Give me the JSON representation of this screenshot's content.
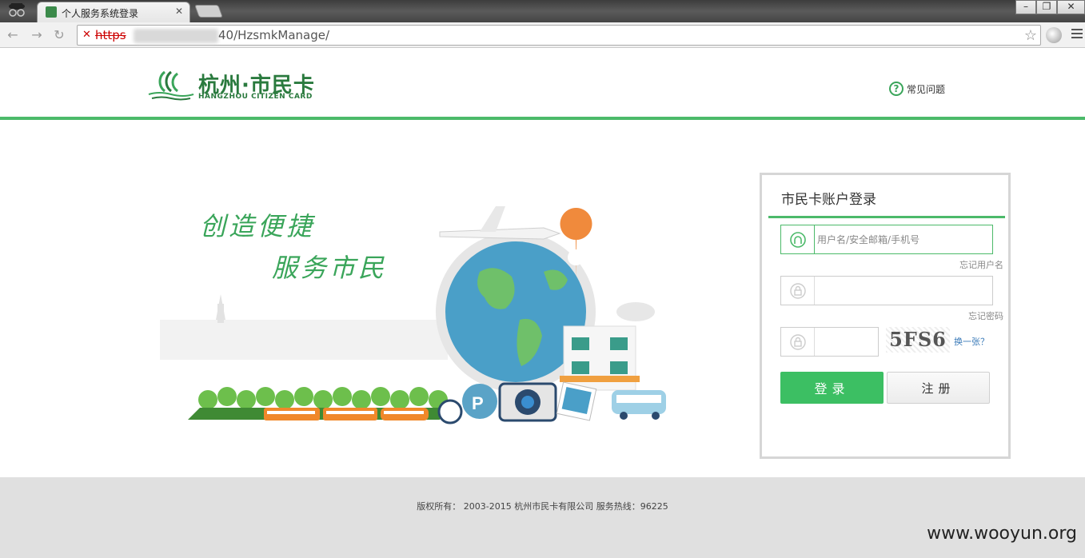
{
  "browser": {
    "tab_title": "个人服务系统登录",
    "url_scheme": "https",
    "url_path": "40/HzsmkManage/"
  },
  "header": {
    "logo_cn": "杭州·市民卡",
    "logo_en": "HANGZHOU CITIZEN CARD",
    "faq_label": "常见问题"
  },
  "hero": {
    "slogan_line1": "创造便捷",
    "slogan_line2": "服务市民"
  },
  "login": {
    "title": "市民卡账户登录",
    "username_placeholder": "用户名/安全邮箱/手机号",
    "forgot_username": "忘记用户名",
    "forgot_password": "忘记密码",
    "captcha_text": "5FS6",
    "captcha_change": "换一张？",
    "login_button": "登录",
    "register_button": "注册"
  },
  "footer": {
    "copyright": "版权所有： 2003-2015 杭州市民卡有限公司 服务热线：96225",
    "watermark": "www.wooyun.org"
  },
  "colors": {
    "brand_green": "#3cbf63",
    "header_line": "#4cba6a",
    "logo_green": "#2a7a3e"
  }
}
